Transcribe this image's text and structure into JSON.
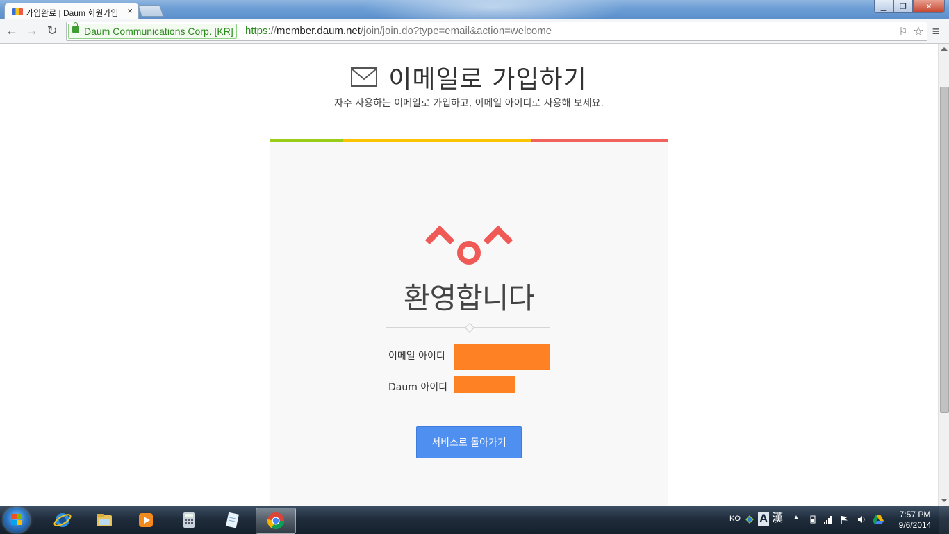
{
  "browser": {
    "tab_title": "가입완료 | Daum 회원가입",
    "tab_close": "×",
    "ev_label": "Daum Communications Corp. [KR]",
    "url_scheme": "https",
    "url_sep": "://",
    "url_host": "member.daum.net",
    "url_path": "/join/join.do?type=email&action=welcome",
    "back_icon": "←",
    "forward_icon": "→",
    "reload_icon": "↻",
    "menu_icon": "≡",
    "star_icon": "☆",
    "translate_icon": "⚐"
  },
  "page": {
    "heading": "이메일로 가입하기",
    "subheading": "자주 사용하는 이메일로 가입하고, 이메일 아이디로 사용해 보세요.",
    "welcome_text": "환영합니다",
    "email_id_label": "이메일 아이디",
    "email_id_value": "",
    "daum_id_label": "Daum 아이디",
    "daum_id_value": "",
    "back_to_service_button": "서비스로 돌아가기",
    "colors": {
      "bar_green": "#9acd1a",
      "bar_yellow": "#fcc400",
      "bar_red": "#f0625b",
      "logo_red": "#ef5a56",
      "redaction": "#fe8223",
      "button_blue": "#4f8ff0"
    }
  },
  "taskbar": {
    "language": "KO",
    "ime_mode": "A",
    "ime_hanja": "漢",
    "clock_time": "7:57 PM",
    "clock_date": "9/6/2014",
    "apps": [
      "internet-explorer",
      "windows-explorer",
      "media-player",
      "calculator",
      "notepad",
      "chrome"
    ]
  }
}
